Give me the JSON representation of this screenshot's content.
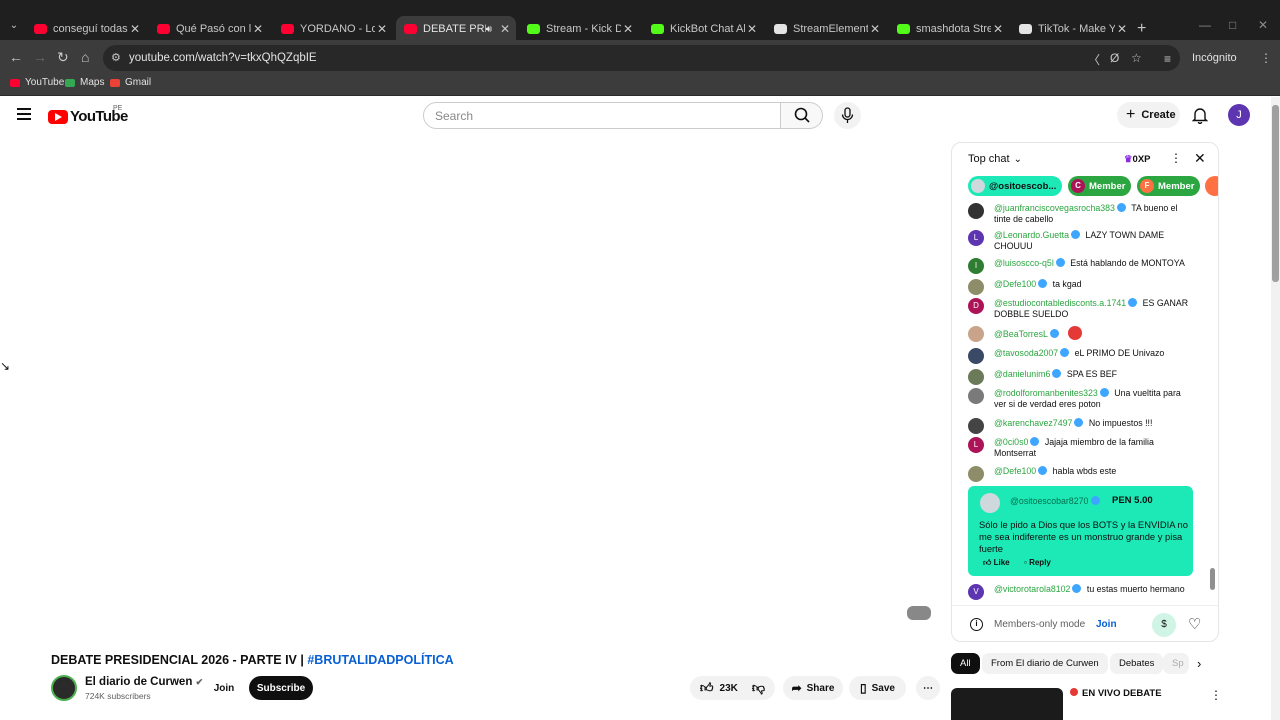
{
  "browser": {
    "tabs": [
      {
        "title": "conseguí todas las m",
        "color": "#ff0033"
      },
      {
        "title": "Qué Pasó con los PR",
        "color": "#ff0033"
      },
      {
        "title": "YORDANO - Locos de",
        "color": "#ff0033"
      },
      {
        "title": "DEBATE PRESIDEN",
        "color": "#ff0033",
        "active": true
      },
      {
        "title": "Stream - Kick Dashbo",
        "color": "#53fc18"
      },
      {
        "title": "KickBot Chat Alerts",
        "color": "#53fc18"
      },
      {
        "title": "StreamElements - em",
        "color": "#e3e3e3"
      },
      {
        "title": "smashdota Stream -",
        "color": "#53fc18"
      },
      {
        "title": "TikTok - Make Your D",
        "color": "#e3e3e3"
      }
    ],
    "url": "youtube.com/watch?v=tkxQhQZqbIE",
    "profile_label": "Incógnito",
    "bookmarks": [
      "YouTube",
      "Maps",
      "Gmail"
    ]
  },
  "youtube": {
    "logo_text": "YouTube",
    "country_code": "PE",
    "search_placeholder": "Search",
    "create_label": "Create",
    "avatar_letter": "J"
  },
  "video": {
    "title": "DEBATE PRESIDENCIAL 2026 - PARTE IV | ",
    "hashtag": "#BRUTALIDADPOLÍTICA",
    "channel": "El diario de Curwen",
    "subscribers": "724K subscribers",
    "join_label": "Join",
    "subscribe_label": "Subscribe",
    "likes": "23K",
    "share_label": "Share",
    "save_label": "Save"
  },
  "chat": {
    "mode_label": "Top chat",
    "xp": "0XP",
    "tickers": [
      {
        "label": "@ositoescob...",
        "color": "#1de9b6",
        "text_color": "#0f0f0f",
        "avatar": ""
      },
      {
        "label": "Member",
        "color": "#2ba640",
        "text_color": "#ffffff",
        "avatar": "C"
      },
      {
        "label": "Member",
        "color": "#2ba640",
        "text_color": "#ffffff",
        "avatar": "F"
      }
    ],
    "messages": [
      {
        "author": "@juanfranciscovegasrocha383",
        "text": "TA bueno el tinte de cabello",
        "avatar": "",
        "avatar_color": "#333333"
      },
      {
        "author": "@Leonardo.Guetta",
        "text": "LAZY TOWN DAME CHOUUU",
        "avatar": "L",
        "avatar_color": "#5e35b1"
      },
      {
        "author": "@luisoscco-q5l",
        "text": "Está hablando de MONTOYA",
        "avatar": "l",
        "avatar_color": "#2e7d32"
      },
      {
        "author": "@Defe100",
        "text": "ta kgad",
        "avatar": "",
        "avatar_color": "#8d8d6a"
      },
      {
        "author": "@estudiocontabledisconts.a.1741",
        "text": "ES GANAR DOBBLE SUELDO",
        "avatar": "D",
        "avatar_color": "#ad1457"
      },
      {
        "author": "@BeaTorresL",
        "text": "",
        "avatar": "",
        "avatar_color": "#c9a48a"
      },
      {
        "author": "@tavosoda2007",
        "text": "eL PRIMO DE Univazo",
        "avatar": "",
        "avatar_color": "#3a4a66"
      },
      {
        "author": "@danielunim6",
        "text": "SPA ES BEF",
        "avatar": "",
        "avatar_color": "#6b7b5a"
      },
      {
        "author": "@rodolforomanbenites323",
        "text": "Una vueltita para ver si de verdad eres poton",
        "avatar": "",
        "avatar_color": "#7a7a7a"
      },
      {
        "author": "@karenchavez7497",
        "text": "No impuestos !!!",
        "avatar": "",
        "avatar_color": "#444444"
      },
      {
        "author": "@0ci0s0",
        "text": "Jajaja miembro de la familia Montserrat",
        "avatar": "L",
        "avatar_color": "#ad1457"
      },
      {
        "author": "@Defe100",
        "text": "habla wbds este",
        "avatar": "",
        "avatar_color": "#8d8d6a"
      }
    ],
    "superchat": {
      "author": "@ositoescobar8270",
      "amount": "PEN 5.00",
      "text": "Sólo le pido a Dios que los BOTS y la ENVIDIA no me sea indiferente es un monstruo grande y pisa fuerte",
      "like_label": "Like",
      "reply_label": "Reply"
    },
    "last_message": {
      "author": "@victorotarola8102",
      "text": "tu estas muerto hermano",
      "avatar": "V",
      "avatar_color": "#5e35b1"
    },
    "members_only_label": "Members-only mode",
    "join_label": "Join"
  },
  "recommendations": {
    "chips": [
      "All",
      "From El diario de Curwen",
      "Debates",
      "Sp"
    ],
    "first_title": "EN VIVO DEBATE"
  }
}
